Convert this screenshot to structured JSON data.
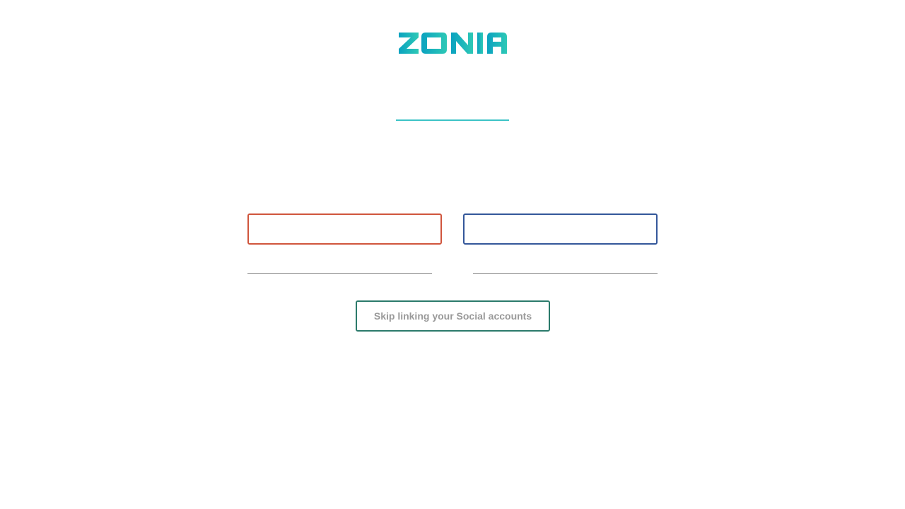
{
  "brand": {
    "logo_text": "ZONIA",
    "gradient_start": "#0aa2c0",
    "gradient_end": "#2ec9b6"
  },
  "heading": {
    "underline_color": "#3cc3c6"
  },
  "social": {
    "google_border_color": "#d0553c",
    "facebook_border_color": "#34579a"
  },
  "skip": {
    "label": "Skip linking your Social accounts",
    "border_color": "#2b7a6b"
  }
}
